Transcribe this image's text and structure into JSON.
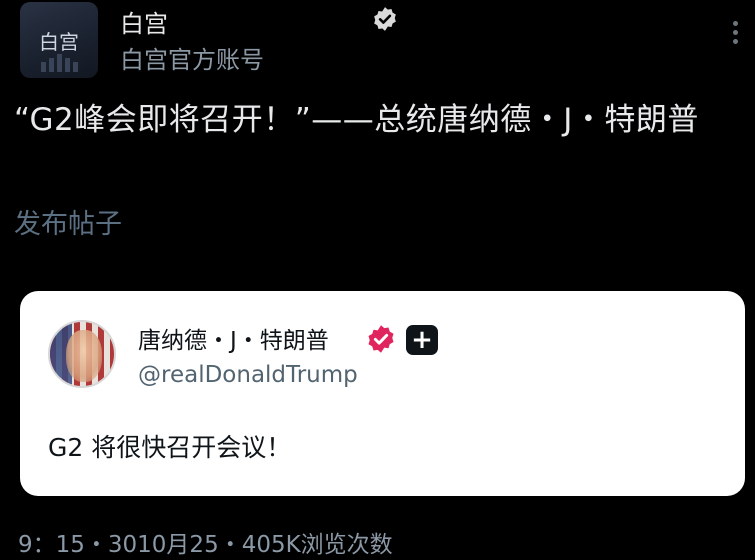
{
  "author": {
    "avatar_text": "白宫",
    "name": "白宫",
    "handle": "白宫官方账号",
    "verified_icon": "verified-badge-icon",
    "verified_color": "#ffffff"
  },
  "post": {
    "text": "“G2峰会即将召开！”——总统唐纳德・J・特朗普",
    "link_label": "发布帖子"
  },
  "quoted": {
    "name": "唐纳德・J・特朗普",
    "handle": "@realDonaldTrump",
    "text": "G2 将很快召开会议！",
    "verified_color": "#e0245e",
    "plus_symbol": "+"
  },
  "meta": {
    "text": "9：15・3010月25・405K浏览次数"
  }
}
